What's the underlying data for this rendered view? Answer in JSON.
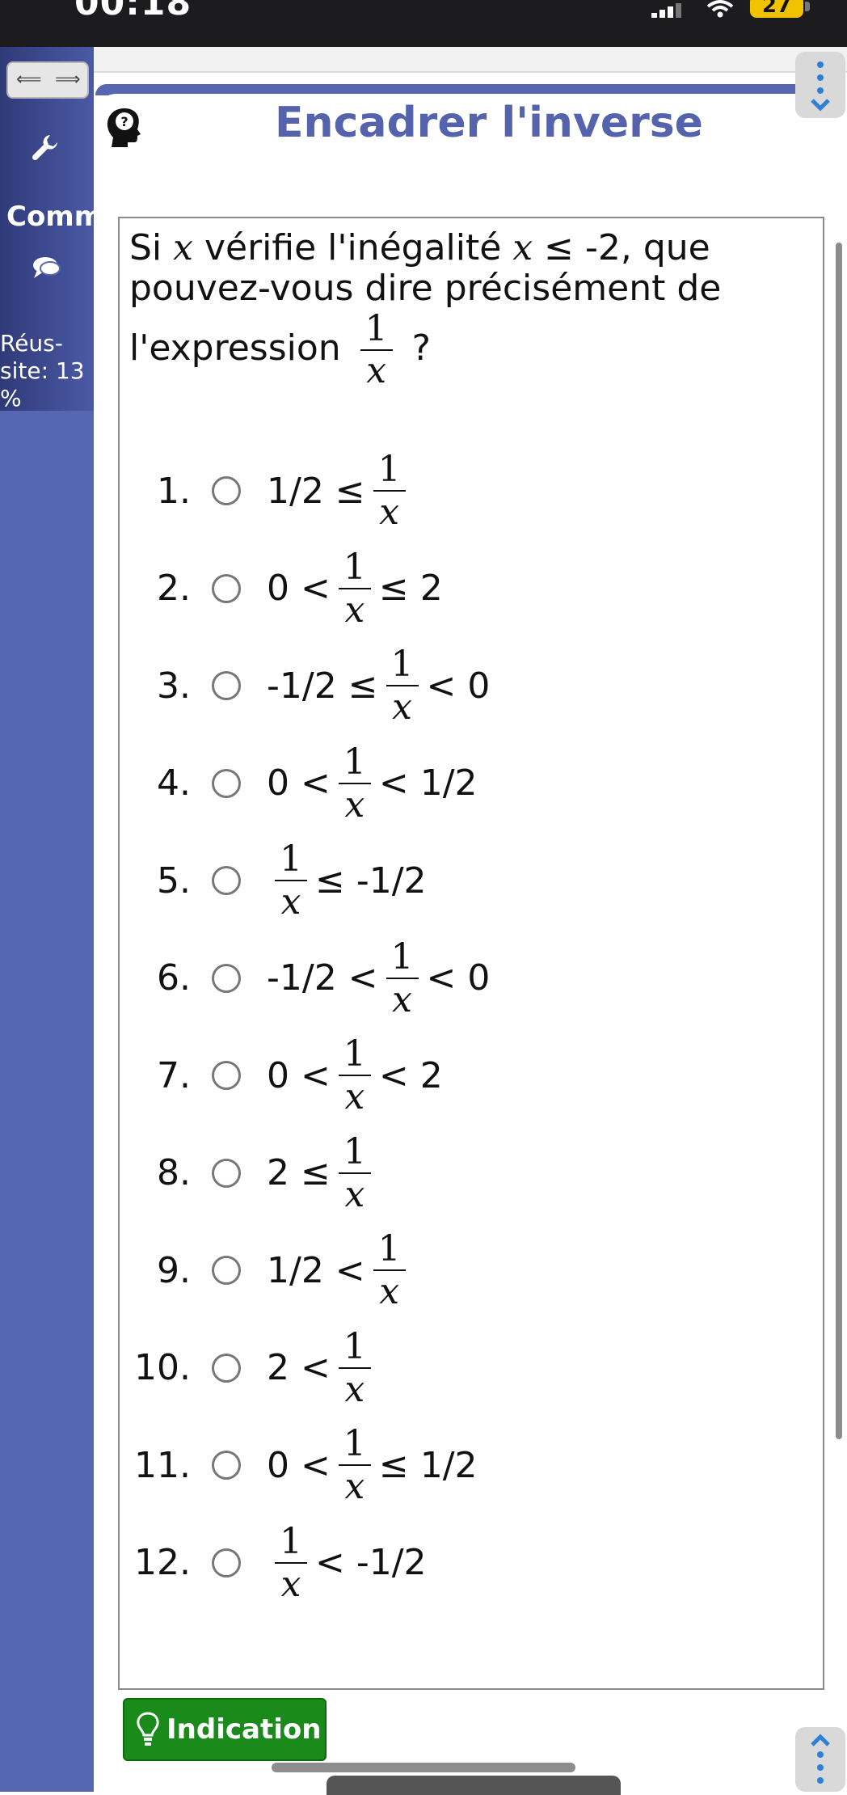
{
  "status_bar": {
    "time": "00:18",
    "battery": "27"
  },
  "sidebar": {
    "comm_label": "Comm",
    "reussite": "Réus-\nsite: 13\n%"
  },
  "page": {
    "title": "Encadrer l'inverse"
  },
  "question": {
    "part1": "Si ",
    "var": "x",
    "part2": " vérifie l'inégalité ",
    "var2": "x",
    "part3": " ≤ -2, que pouvez-vous dire précisément de l'expression",
    "frac_num": "1",
    "frac_den": "x",
    "part4": " ?"
  },
  "options": [
    {
      "num": "1.",
      "left": "1/2 ≤",
      "right": ""
    },
    {
      "num": "2.",
      "left": "0 <",
      "right": "≤ 2"
    },
    {
      "num": "3.",
      "left": "-1/2 ≤",
      "right": "< 0"
    },
    {
      "num": "4.",
      "left": "0 <",
      "right": "< 1/2"
    },
    {
      "num": "5.",
      "left": "",
      "right": "≤ -1/2"
    },
    {
      "num": "6.",
      "left": "-1/2 <",
      "right": "< 0"
    },
    {
      "num": "7.",
      "left": "0 <",
      "right": "< 2"
    },
    {
      "num": "8.",
      "left": "2 ≤",
      "right": ""
    },
    {
      "num": "9.",
      "left": "1/2 <",
      "right": ""
    },
    {
      "num": "10.",
      "left": "2 <",
      "right": ""
    },
    {
      "num": "11.",
      "left": "0 <",
      "right": "≤ 1/2"
    },
    {
      "num": "12.",
      "left": "",
      "right": "< -1/2"
    }
  ],
  "hint_button": {
    "label": "Indication"
  },
  "colors": {
    "accent": "#5563ad",
    "sidebar": "#5766b0",
    "hint": "#1a8a1a"
  }
}
